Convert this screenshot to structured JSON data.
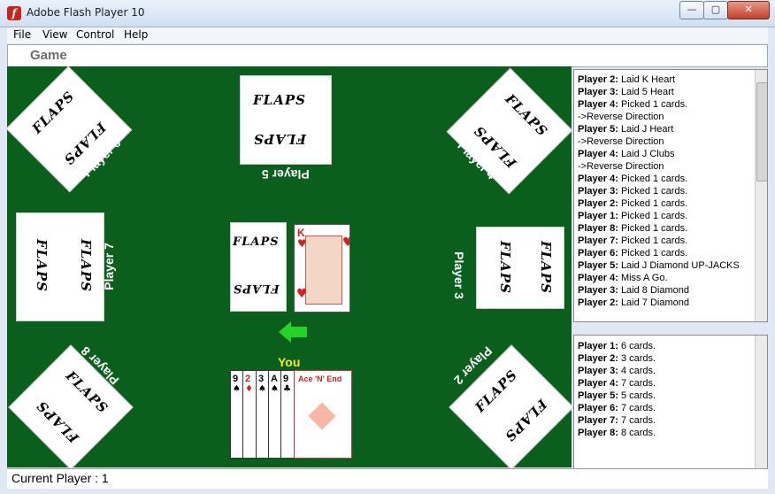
{
  "window": {
    "title": "Adobe Flash Player 10",
    "buttons": {
      "minimize": "—",
      "maximize": "▢",
      "close": "✕"
    }
  },
  "menu": [
    {
      "label": "File"
    },
    {
      "label": "View"
    },
    {
      "label": "Control"
    },
    {
      "label": "Help"
    }
  ],
  "header": {
    "title": "Game"
  },
  "players": {
    "p2": "Player 2",
    "p3": "Player 3",
    "p4": "Player 4",
    "p5": "Player 5",
    "p6": "Player 6",
    "p7": "Player 7",
    "p8": "Player 8",
    "you": "You"
  },
  "card_back_text": "FLAPS",
  "discard_top": {
    "rank": "K",
    "suit": "♥"
  },
  "hand": [
    {
      "rank": "9",
      "suit": "♠"
    },
    {
      "rank": "2",
      "suit": "♦"
    },
    {
      "rank": "3",
      "suit": "♠"
    },
    {
      "rank": "A",
      "suit": "♠"
    },
    {
      "rank": "9",
      "suit": "♣"
    }
  ],
  "special_card": {
    "title": "Ace 'N' End"
  },
  "log": [
    {
      "player": "Player 2:",
      "text": "Laid K Heart"
    },
    {
      "player": "Player 3:",
      "text": "Laid 5 Heart"
    },
    {
      "player": "Player 4:",
      "text": "Picked 1 cards."
    },
    {
      "player": "",
      "text": "->Reverse Direction"
    },
    {
      "player": "Player 5:",
      "text": "Laid J Heart"
    },
    {
      "player": "",
      "text": "->Reverse Direction"
    },
    {
      "player": "Player 4:",
      "text": "Laid J Clubs"
    },
    {
      "player": "",
      "text": "->Reverse Direction"
    },
    {
      "player": "Player 4:",
      "text": "Picked 1 cards."
    },
    {
      "player": "Player 3:",
      "text": "Picked 1 cards."
    },
    {
      "player": "Player 2:",
      "text": "Picked 1 cards."
    },
    {
      "player": "Player 1:",
      "text": "Picked 1 cards."
    },
    {
      "player": "Player 8:",
      "text": "Picked 1 cards."
    },
    {
      "player": "Player 7:",
      "text": "Picked 1 cards."
    },
    {
      "player": "Player 6:",
      "text": "Picked 1 cards."
    },
    {
      "player": "Player 5:",
      "text": "Laid J Diamond UP-JACKS"
    },
    {
      "player": "Player 4:",
      "text": "Miss A Go."
    },
    {
      "player": "Player 3:",
      "text": "Laid 8 Diamond"
    },
    {
      "player": "Player 2:",
      "text": "Laid 7 Diamond"
    }
  ],
  "counts": [
    {
      "player": "Player 1:",
      "text": "6 cards."
    },
    {
      "player": "Player 2:",
      "text": "3 cards."
    },
    {
      "player": "Player 3:",
      "text": "4 cards."
    },
    {
      "player": "Player 4:",
      "text": "7 cards."
    },
    {
      "player": "Player 5:",
      "text": "5 cards."
    },
    {
      "player": "Player 6:",
      "text": "7 cards."
    },
    {
      "player": "Player 7:",
      "text": "7 cards."
    },
    {
      "player": "Player 8:",
      "text": "8 cards."
    }
  ],
  "status": {
    "text": "Current Player : 1"
  },
  "colors": {
    "table": "#0b5f1c",
    "you_label": "#f7ea1d",
    "arrow": "#22d42a",
    "hearts": "#d42020"
  }
}
